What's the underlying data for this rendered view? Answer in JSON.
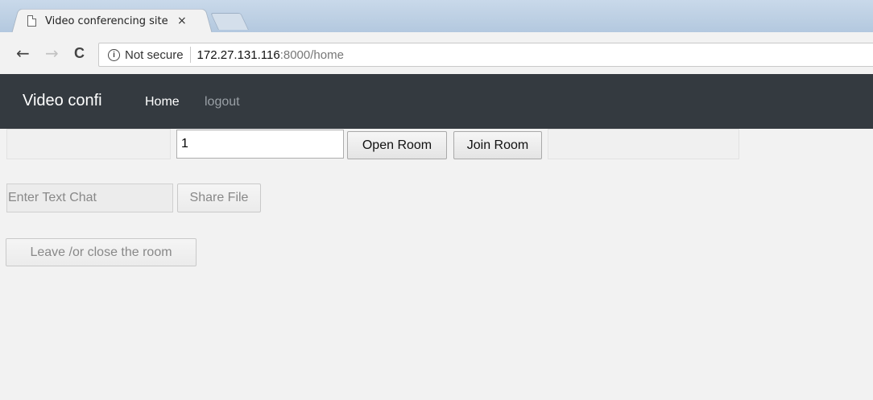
{
  "browser": {
    "tab_title": "Video conferencing site",
    "tab_close": "×",
    "nav": {
      "back": "←",
      "forward": "→",
      "reload": "C"
    },
    "security_label": "Not secure",
    "url_host": "172.27.131.116",
    "url_path": ":8000/home"
  },
  "navbar": {
    "brand": "Video confi",
    "links": [
      {
        "label": "Home",
        "active": true
      },
      {
        "label": "logout",
        "active": false
      }
    ]
  },
  "room_controls": {
    "room_id_value": "1",
    "open_room_label": "Open Room",
    "join_room_label": "Join Room"
  },
  "chat": {
    "placeholder": "Enter Text Chat",
    "share_file_label": "Share File"
  },
  "leave_label": "Leave /or close the room",
  "colors": {
    "navbar_bg": "#343a40",
    "page_bg": "#f2f2f2",
    "disabled_text": "#888888"
  }
}
